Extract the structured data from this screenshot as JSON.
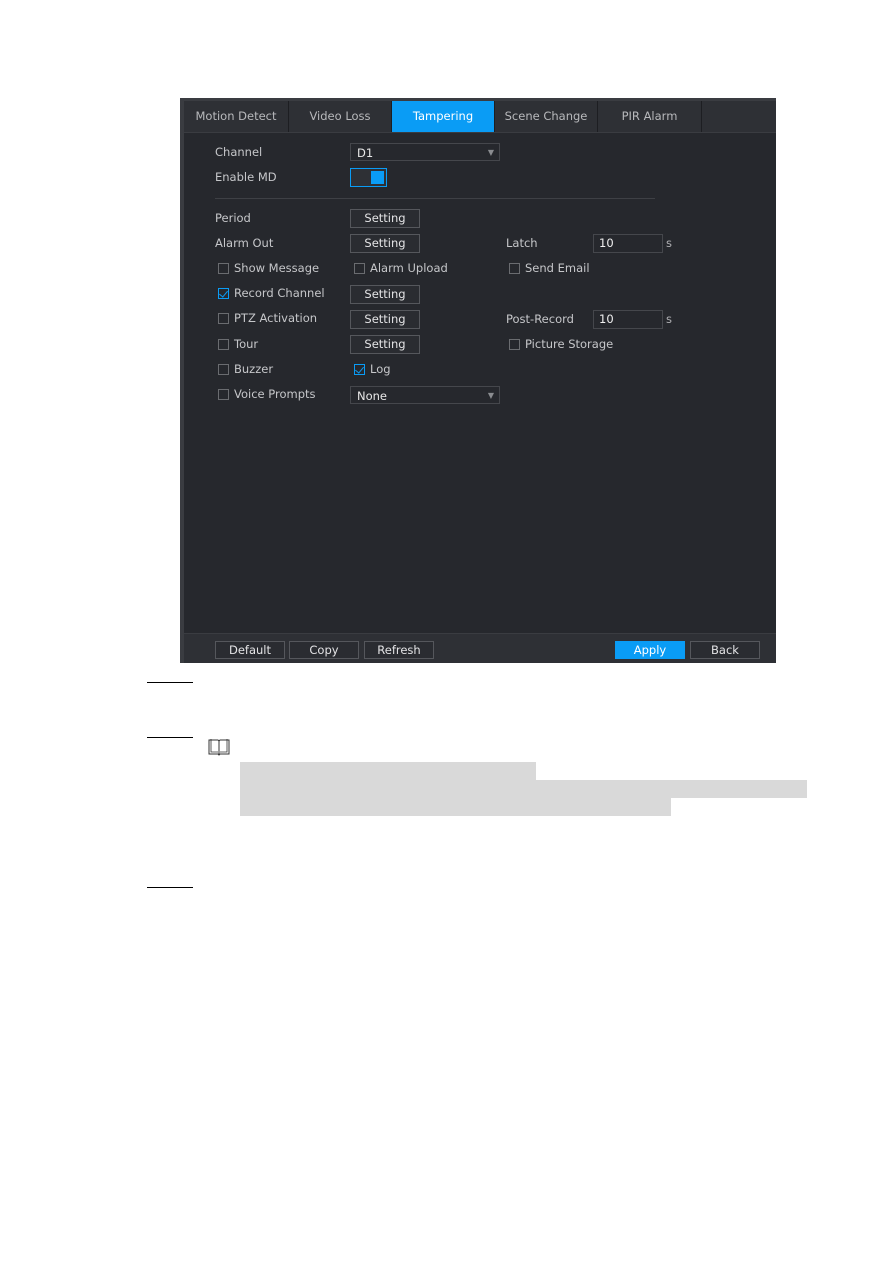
{
  "tabs": [
    {
      "label": "Motion Detect",
      "active": false
    },
    {
      "label": "Video Loss",
      "active": false
    },
    {
      "label": "Tampering",
      "active": true
    },
    {
      "label": "Scene Change",
      "active": false
    },
    {
      "label": "PIR Alarm",
      "active": false
    }
  ],
  "form": {
    "channel_label": "Channel",
    "channel_value": "D1",
    "enable_label": "Enable MD",
    "enable_on": true,
    "period_label": "Period",
    "alarm_out_label": "Alarm Out",
    "setting_label": "Setting",
    "latch_label": "Latch",
    "latch_value": "10",
    "latch_unit": "s",
    "show_message": {
      "label": "Show Message",
      "checked": false
    },
    "alarm_upload": {
      "label": "Alarm Upload",
      "checked": false
    },
    "send_email": {
      "label": "Send Email",
      "checked": false
    },
    "record_channel": {
      "label": "Record Channel",
      "checked": true
    },
    "ptz_activation": {
      "label": "PTZ Activation",
      "checked": false
    },
    "post_record_label": "Post-Record",
    "post_record_value": "10",
    "post_record_unit": "s",
    "tour": {
      "label": "Tour",
      "checked": false
    },
    "picture_storage": {
      "label": "Picture Storage",
      "checked": false
    },
    "buzzer": {
      "label": "Buzzer",
      "checked": false
    },
    "log": {
      "label": "Log",
      "checked": true
    },
    "voice_prompts": {
      "label": "Voice Prompts",
      "checked": false
    },
    "voice_prompts_value": "None"
  },
  "footer": {
    "default_label": "Default",
    "copy_label": "Copy",
    "refresh_label": "Refresh",
    "apply_label": "Apply",
    "back_label": "Back"
  },
  "colors": {
    "accent": "#0a9cf5",
    "panel_bg": "#26282d",
    "note_highlight": "#d9d9d9"
  },
  "document": {
    "note_icon": "book-icon"
  }
}
